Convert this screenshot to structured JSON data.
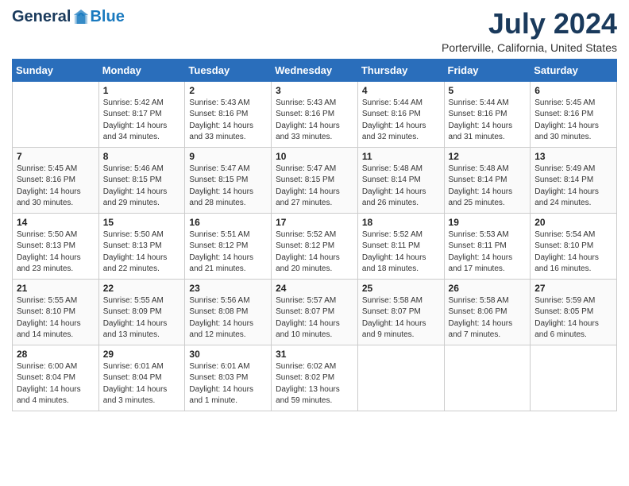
{
  "header": {
    "logo_general": "General",
    "logo_blue": "Blue",
    "title": "July 2024",
    "subtitle": "Porterville, California, United States"
  },
  "calendar": {
    "days_of_week": [
      "Sunday",
      "Monday",
      "Tuesday",
      "Wednesday",
      "Thursday",
      "Friday",
      "Saturday"
    ],
    "weeks": [
      [
        {
          "day": "",
          "sunrise": "",
          "sunset": "",
          "daylight": ""
        },
        {
          "day": "1",
          "sunrise": "Sunrise: 5:42 AM",
          "sunset": "Sunset: 8:17 PM",
          "daylight": "Daylight: 14 hours and 34 minutes."
        },
        {
          "day": "2",
          "sunrise": "Sunrise: 5:43 AM",
          "sunset": "Sunset: 8:16 PM",
          "daylight": "Daylight: 14 hours and 33 minutes."
        },
        {
          "day": "3",
          "sunrise": "Sunrise: 5:43 AM",
          "sunset": "Sunset: 8:16 PM",
          "daylight": "Daylight: 14 hours and 33 minutes."
        },
        {
          "day": "4",
          "sunrise": "Sunrise: 5:44 AM",
          "sunset": "Sunset: 8:16 PM",
          "daylight": "Daylight: 14 hours and 32 minutes."
        },
        {
          "day": "5",
          "sunrise": "Sunrise: 5:44 AM",
          "sunset": "Sunset: 8:16 PM",
          "daylight": "Daylight: 14 hours and 31 minutes."
        },
        {
          "day": "6",
          "sunrise": "Sunrise: 5:45 AM",
          "sunset": "Sunset: 8:16 PM",
          "daylight": "Daylight: 14 hours and 30 minutes."
        }
      ],
      [
        {
          "day": "7",
          "sunrise": "Sunrise: 5:45 AM",
          "sunset": "Sunset: 8:16 PM",
          "daylight": "Daylight: 14 hours and 30 minutes."
        },
        {
          "day": "8",
          "sunrise": "Sunrise: 5:46 AM",
          "sunset": "Sunset: 8:15 PM",
          "daylight": "Daylight: 14 hours and 29 minutes."
        },
        {
          "day": "9",
          "sunrise": "Sunrise: 5:47 AM",
          "sunset": "Sunset: 8:15 PM",
          "daylight": "Daylight: 14 hours and 28 minutes."
        },
        {
          "day": "10",
          "sunrise": "Sunrise: 5:47 AM",
          "sunset": "Sunset: 8:15 PM",
          "daylight": "Daylight: 14 hours and 27 minutes."
        },
        {
          "day": "11",
          "sunrise": "Sunrise: 5:48 AM",
          "sunset": "Sunset: 8:14 PM",
          "daylight": "Daylight: 14 hours and 26 minutes."
        },
        {
          "day": "12",
          "sunrise": "Sunrise: 5:48 AM",
          "sunset": "Sunset: 8:14 PM",
          "daylight": "Daylight: 14 hours and 25 minutes."
        },
        {
          "day": "13",
          "sunrise": "Sunrise: 5:49 AM",
          "sunset": "Sunset: 8:14 PM",
          "daylight": "Daylight: 14 hours and 24 minutes."
        }
      ],
      [
        {
          "day": "14",
          "sunrise": "Sunrise: 5:50 AM",
          "sunset": "Sunset: 8:13 PM",
          "daylight": "Daylight: 14 hours and 23 minutes."
        },
        {
          "day": "15",
          "sunrise": "Sunrise: 5:50 AM",
          "sunset": "Sunset: 8:13 PM",
          "daylight": "Daylight: 14 hours and 22 minutes."
        },
        {
          "day": "16",
          "sunrise": "Sunrise: 5:51 AM",
          "sunset": "Sunset: 8:12 PM",
          "daylight": "Daylight: 14 hours and 21 minutes."
        },
        {
          "day": "17",
          "sunrise": "Sunrise: 5:52 AM",
          "sunset": "Sunset: 8:12 PM",
          "daylight": "Daylight: 14 hours and 20 minutes."
        },
        {
          "day": "18",
          "sunrise": "Sunrise: 5:52 AM",
          "sunset": "Sunset: 8:11 PM",
          "daylight": "Daylight: 14 hours and 18 minutes."
        },
        {
          "day": "19",
          "sunrise": "Sunrise: 5:53 AM",
          "sunset": "Sunset: 8:11 PM",
          "daylight": "Daylight: 14 hours and 17 minutes."
        },
        {
          "day": "20",
          "sunrise": "Sunrise: 5:54 AM",
          "sunset": "Sunset: 8:10 PM",
          "daylight": "Daylight: 14 hours and 16 minutes."
        }
      ],
      [
        {
          "day": "21",
          "sunrise": "Sunrise: 5:55 AM",
          "sunset": "Sunset: 8:10 PM",
          "daylight": "Daylight: 14 hours and 14 minutes."
        },
        {
          "day": "22",
          "sunrise": "Sunrise: 5:55 AM",
          "sunset": "Sunset: 8:09 PM",
          "daylight": "Daylight: 14 hours and 13 minutes."
        },
        {
          "day": "23",
          "sunrise": "Sunrise: 5:56 AM",
          "sunset": "Sunset: 8:08 PM",
          "daylight": "Daylight: 14 hours and 12 minutes."
        },
        {
          "day": "24",
          "sunrise": "Sunrise: 5:57 AM",
          "sunset": "Sunset: 8:07 PM",
          "daylight": "Daylight: 14 hours and 10 minutes."
        },
        {
          "day": "25",
          "sunrise": "Sunrise: 5:58 AM",
          "sunset": "Sunset: 8:07 PM",
          "daylight": "Daylight: 14 hours and 9 minutes."
        },
        {
          "day": "26",
          "sunrise": "Sunrise: 5:58 AM",
          "sunset": "Sunset: 8:06 PM",
          "daylight": "Daylight: 14 hours and 7 minutes."
        },
        {
          "day": "27",
          "sunrise": "Sunrise: 5:59 AM",
          "sunset": "Sunset: 8:05 PM",
          "daylight": "Daylight: 14 hours and 6 minutes."
        }
      ],
      [
        {
          "day": "28",
          "sunrise": "Sunrise: 6:00 AM",
          "sunset": "Sunset: 8:04 PM",
          "daylight": "Daylight: 14 hours and 4 minutes."
        },
        {
          "day": "29",
          "sunrise": "Sunrise: 6:01 AM",
          "sunset": "Sunset: 8:04 PM",
          "daylight": "Daylight: 14 hours and 3 minutes."
        },
        {
          "day": "30",
          "sunrise": "Sunrise: 6:01 AM",
          "sunset": "Sunset: 8:03 PM",
          "daylight": "Daylight: 14 hours and 1 minute."
        },
        {
          "day": "31",
          "sunrise": "Sunrise: 6:02 AM",
          "sunset": "Sunset: 8:02 PM",
          "daylight": "Daylight: 13 hours and 59 minutes."
        },
        {
          "day": "",
          "sunrise": "",
          "sunset": "",
          "daylight": ""
        },
        {
          "day": "",
          "sunrise": "",
          "sunset": "",
          "daylight": ""
        },
        {
          "day": "",
          "sunrise": "",
          "sunset": "",
          "daylight": ""
        }
      ]
    ]
  }
}
